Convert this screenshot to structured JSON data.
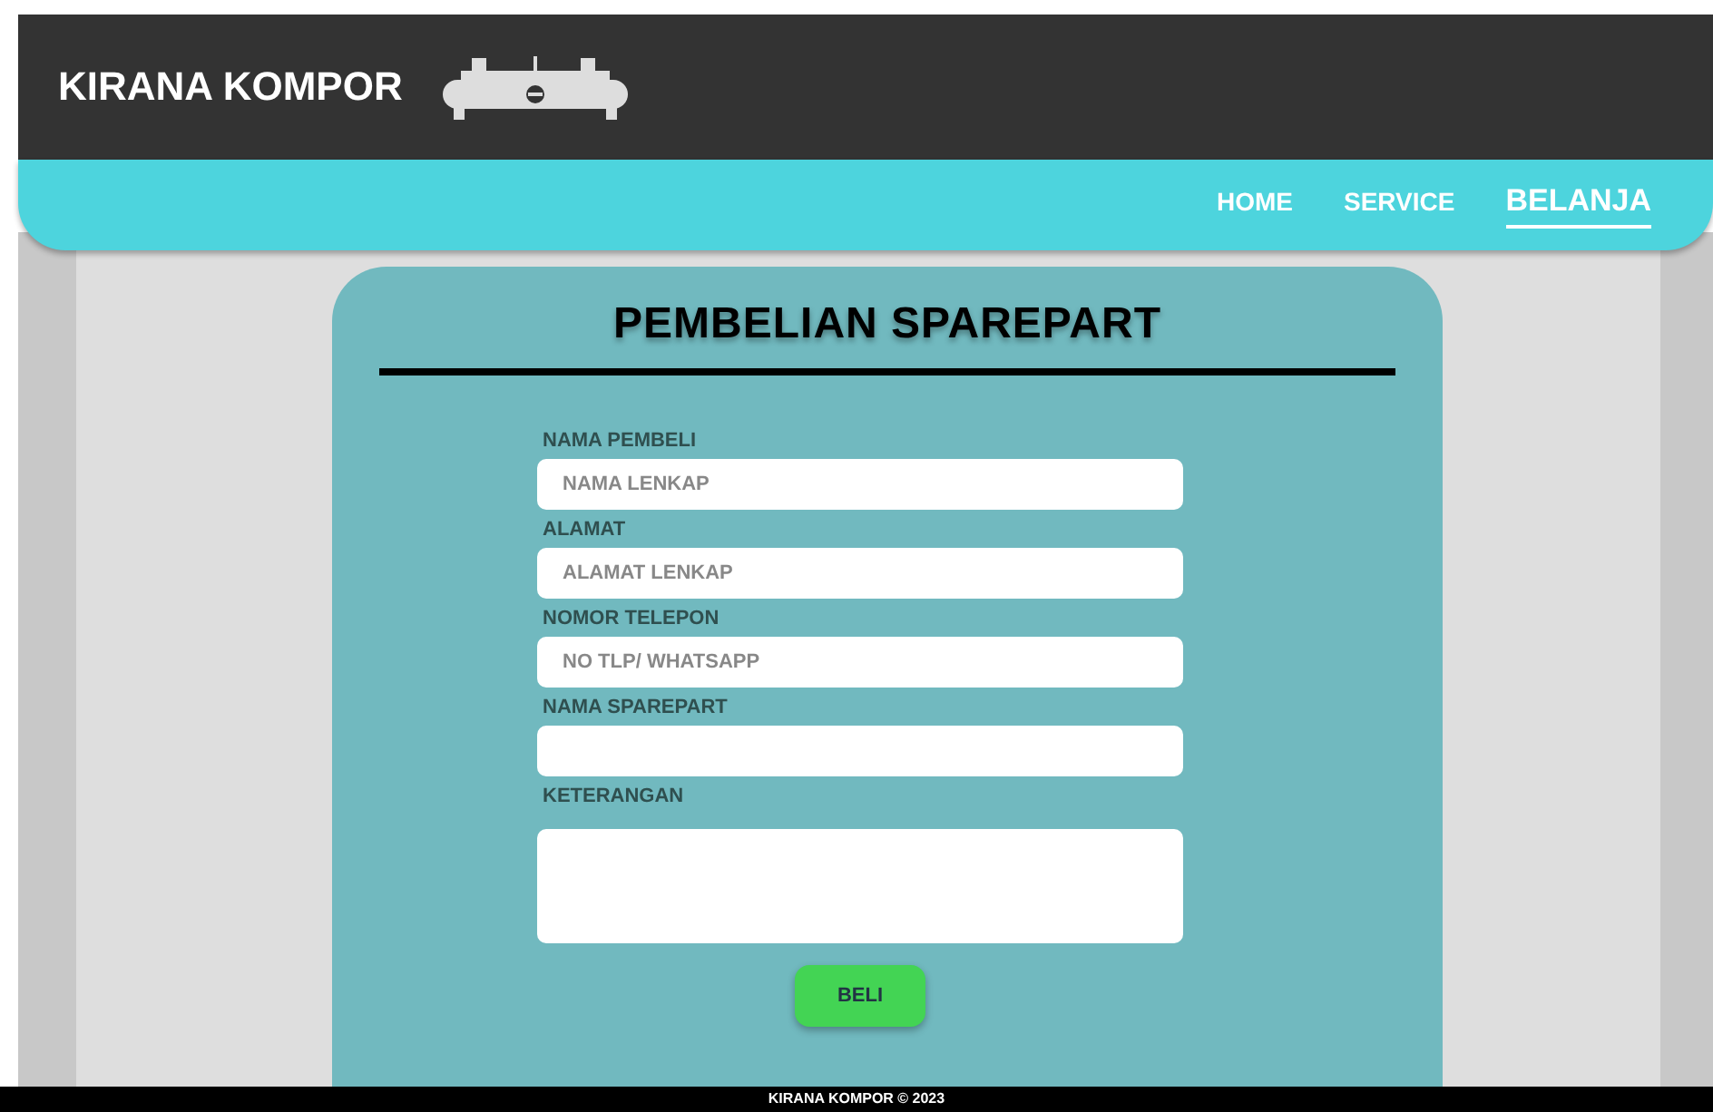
{
  "header": {
    "brand": "KIRANA KOMPOR"
  },
  "nav": [
    {
      "label": "HOME",
      "selected": false
    },
    {
      "label": "SERVICE",
      "selected": false
    },
    {
      "label": "BELANJA",
      "selected": true
    }
  ],
  "form": {
    "title": "PEMBELIAN SPAREPART",
    "fields": [
      {
        "kind": "input",
        "label": "NAMA PEMBELI",
        "placeholder": "NAMA LENKAP"
      },
      {
        "kind": "input",
        "label": "ALAMAT",
        "placeholder": "ALAMAT LENKAP"
      },
      {
        "kind": "input",
        "label": "NOMOR TELEPON",
        "placeholder": "NO TLP/ WHATSAPP"
      },
      {
        "kind": "input",
        "label": "NAMA SPAREPART"
      },
      {
        "kind": "textarea",
        "label": "KETERANGAN"
      }
    ],
    "submit": "BELI"
  },
  "footer": "KIRANA KOMPOR © 2023"
}
